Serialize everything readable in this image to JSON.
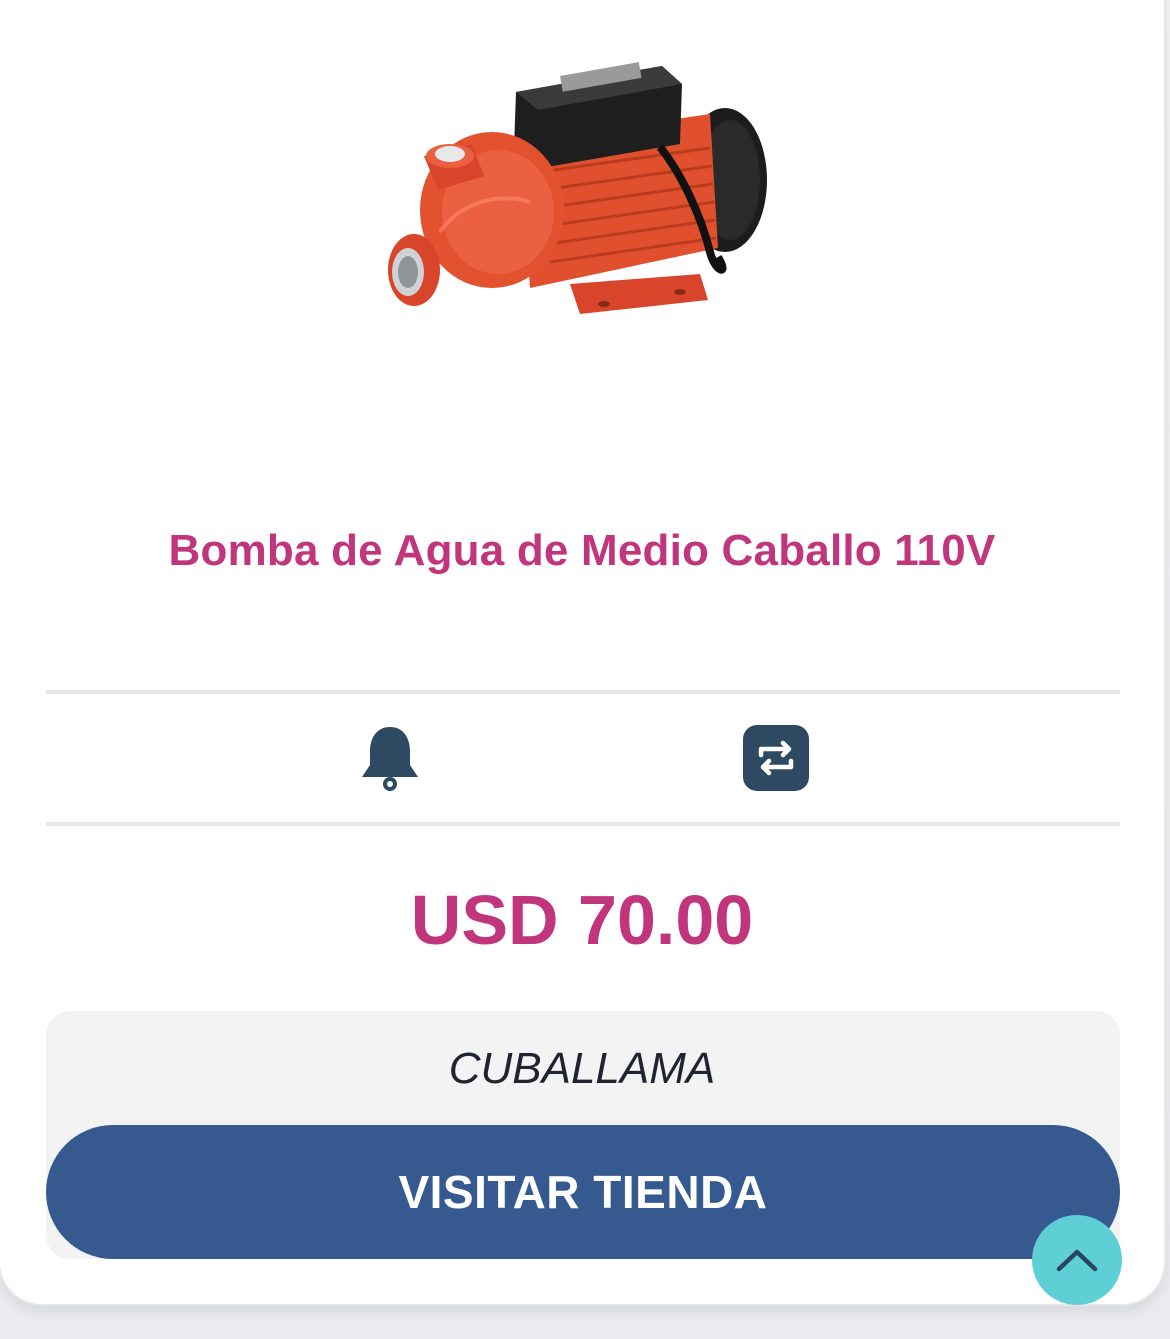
{
  "product": {
    "title": "Bomba de Agua de Medio Caballo 110V",
    "price": "USD 70.00",
    "image_icon": "water-pump-image"
  },
  "actions": {
    "notify_icon": "bell-icon",
    "compare_icon": "compare-arrows-icon"
  },
  "store": {
    "name": "CUBALLAMA",
    "visit_label": "VISITAR TIENDA"
  },
  "scroll_top_icon": "chevron-up-icon",
  "colors": {
    "accent": "#c1357d",
    "button": "#365a8f",
    "icon": "#2e4a63",
    "scroll_top": "#5fcfd6"
  }
}
